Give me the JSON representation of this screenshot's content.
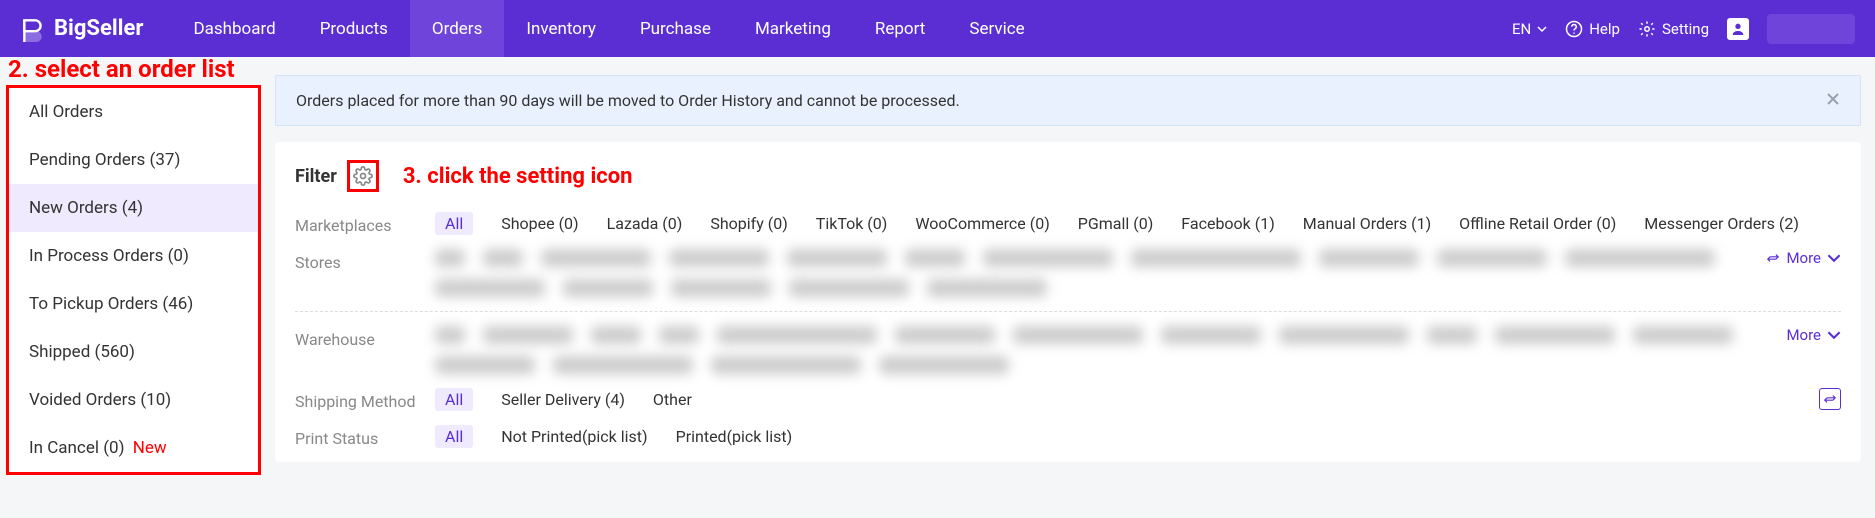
{
  "brand": "BigSeller",
  "nav": {
    "items": [
      "Dashboard",
      "Products",
      "Orders",
      "Inventory",
      "Purchase",
      "Marketing",
      "Report",
      "Service"
    ],
    "activeIndex": 2,
    "lang": "EN",
    "help": "Help",
    "setting": "Setting"
  },
  "annotations": {
    "step2": "2. select an order list",
    "step3": "3. click the setting icon"
  },
  "sidebar": {
    "items": [
      {
        "label": "All Orders"
      },
      {
        "label": "Pending Orders (37)"
      },
      {
        "label": "New Orders (4)",
        "selected": true
      },
      {
        "label": "In Process Orders (0)"
      },
      {
        "label": "To Pickup Orders (46)"
      },
      {
        "label": "Shipped (560)"
      },
      {
        "label": "Voided Orders (10)"
      },
      {
        "label": "In Cancel (0)",
        "newTag": "New"
      }
    ]
  },
  "banner": {
    "text": "Orders placed for more than 90 days will be moved to Order History and cannot be processed."
  },
  "panel": {
    "filterTitle": "Filter",
    "more": "More",
    "rows": {
      "marketplaces": {
        "label": "Marketplaces",
        "all": "All",
        "chips": [
          "Shopee (0)",
          "Lazada (0)",
          "Shopify (0)",
          "TikTok (0)",
          "WooCommerce (0)",
          "PGmall (0)",
          "Facebook (1)",
          "Manual Orders (1)",
          "Offline Retail Order (0)",
          "Messenger Orders (2)"
        ]
      },
      "stores": {
        "label": "Stores",
        "more": "More"
      },
      "warehouse": {
        "label": "Warehouse",
        "more": "More"
      },
      "shipping": {
        "label": "Shipping Method",
        "all": "All",
        "chips": [
          "Seller Delivery (4)",
          "Other"
        ]
      },
      "printstatus": {
        "label": "Print Status",
        "all": "All",
        "chips": [
          "Not Printed(pick list)",
          "Printed(pick list)"
        ]
      }
    }
  }
}
